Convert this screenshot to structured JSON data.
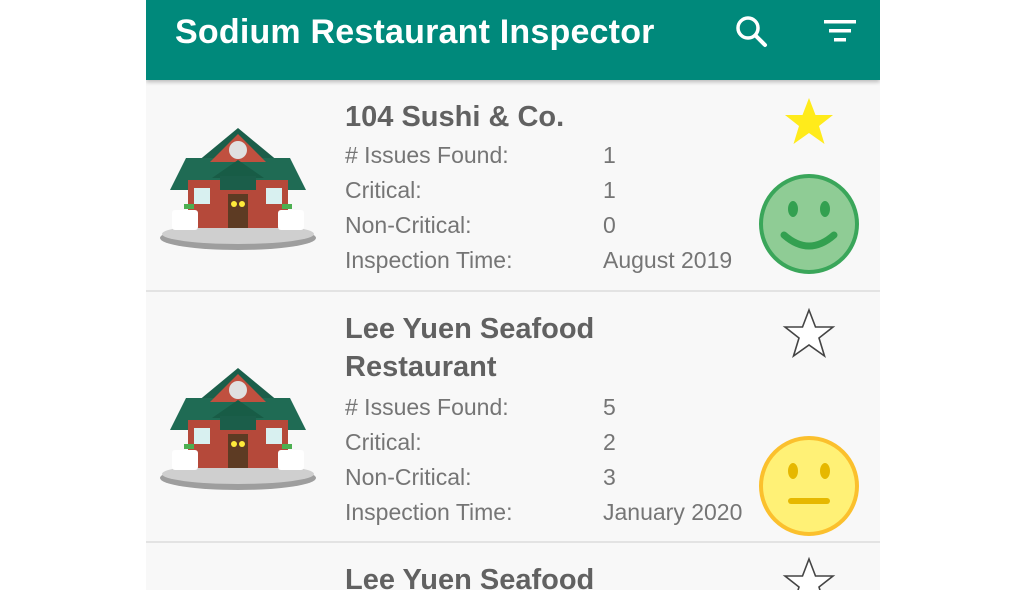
{
  "app": {
    "title": "Sodium Restaurant Inspector",
    "theme_color": "#00897b",
    "toolbar_icons": [
      "search-icon",
      "filter-icon"
    ]
  },
  "labels": {
    "issues": "# Issues Found:",
    "critical": "Critical:",
    "non_critical": "Non-Critical:",
    "time": "Inspection Time:"
  },
  "restaurants": [
    {
      "name": "104 Sushi & Co.",
      "issues": "1",
      "critical": "1",
      "non_critical": "0",
      "inspection_time": "August 2019",
      "favorite": true,
      "hazard": "low",
      "face_icon": "smiley-green-icon",
      "face_color": "#8fcc95"
    },
    {
      "name": "Lee Yuen Seafood Restaurant",
      "issues": "5",
      "critical": "2",
      "non_critical": "3",
      "inspection_time": "January 2020",
      "favorite": false,
      "hazard": "moderate",
      "face_icon": "neutral-yellow-icon",
      "face_color": "#fff176"
    },
    {
      "name": "Lee Yuen Seafood",
      "favorite": false
    }
  ]
}
